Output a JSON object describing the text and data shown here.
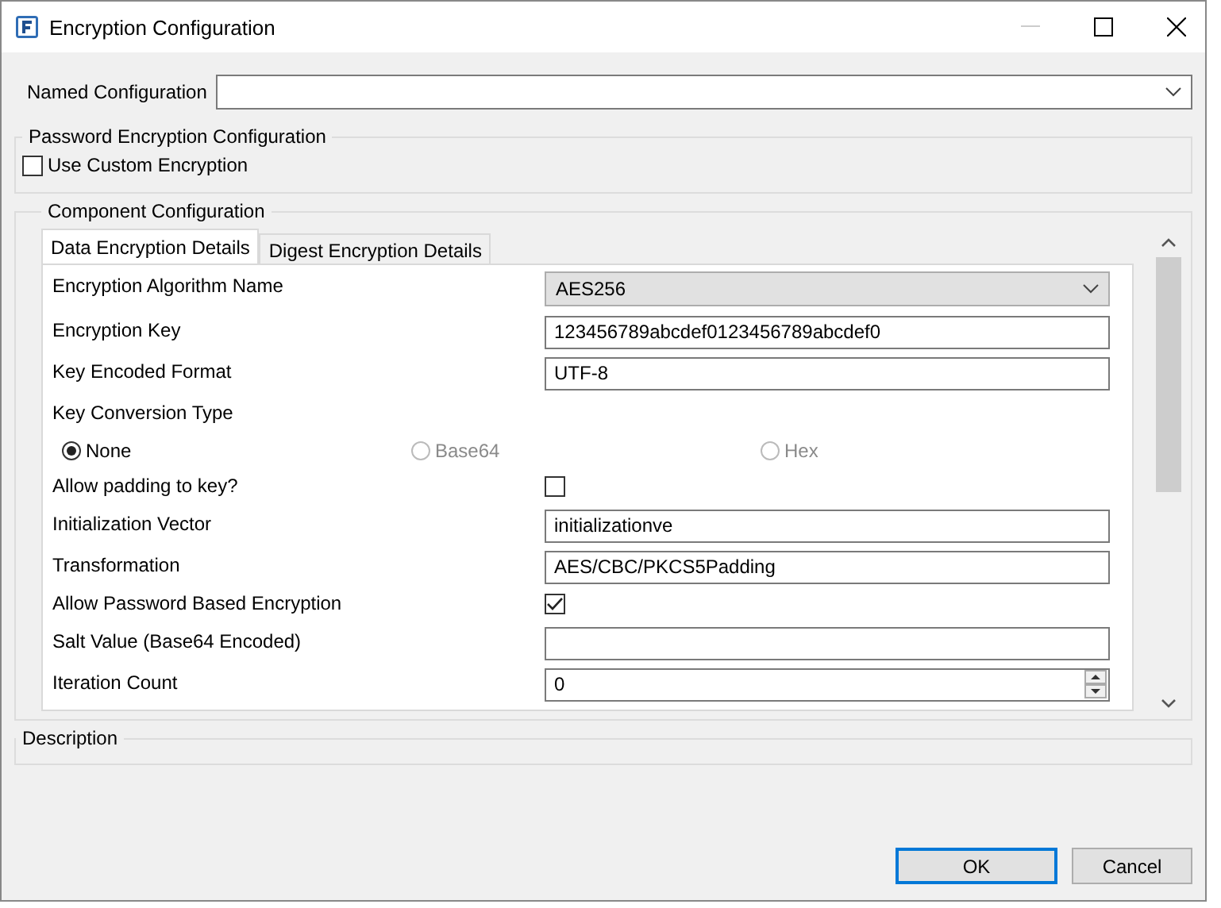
{
  "window": {
    "title": "Encryption Configuration"
  },
  "named_configuration": {
    "label": "Named Configuration"
  },
  "password_group": {
    "title": "Password Encryption Configuration",
    "checkbox": {
      "label": "Use Custom Encryption",
      "checked": false
    }
  },
  "component_group": {
    "title": "Component Configuration",
    "tabs": [
      {
        "label": "Data Encryption Details",
        "selected": true
      },
      {
        "label": "Digest Encryption Details",
        "selected": false
      }
    ],
    "fields": [
      {
        "kind": "select",
        "label": "Encryption Algorithm Name",
        "value": "AES256"
      },
      {
        "kind": "text",
        "label": "Encryption Key",
        "value": "123456789abcdef0123456789abcdef0"
      },
      {
        "kind": "text",
        "label": "Key Encoded Format",
        "value": "UTF-8"
      },
      {
        "kind": "radio",
        "label": "Key Conversion Type",
        "options": [
          {
            "label": "None",
            "selected": true,
            "disabled": false
          },
          {
            "label": "Base64",
            "selected": false,
            "disabled": true
          },
          {
            "label": "Hex",
            "selected": false,
            "disabled": true
          }
        ]
      },
      {
        "kind": "checkbox",
        "label": "Allow padding to key?",
        "checked": false
      },
      {
        "kind": "text",
        "label": "Initialization Vector",
        "value": "initializationve"
      },
      {
        "kind": "text",
        "label": "Transformation",
        "value": "AES/CBC/PKCS5Padding"
      },
      {
        "kind": "checkbox",
        "label": "Allow Password Based Encryption",
        "checked": true
      },
      {
        "kind": "text",
        "label": "Salt Value (Base64 Encoded)"
      },
      {
        "kind": "spinner",
        "label": "Iteration Count",
        "value": "0"
      }
    ]
  },
  "description_group": {
    "title": "Description"
  },
  "buttons": [
    {
      "label": "OK",
      "default": true
    },
    {
      "label": "Cancel",
      "default": false
    }
  ]
}
